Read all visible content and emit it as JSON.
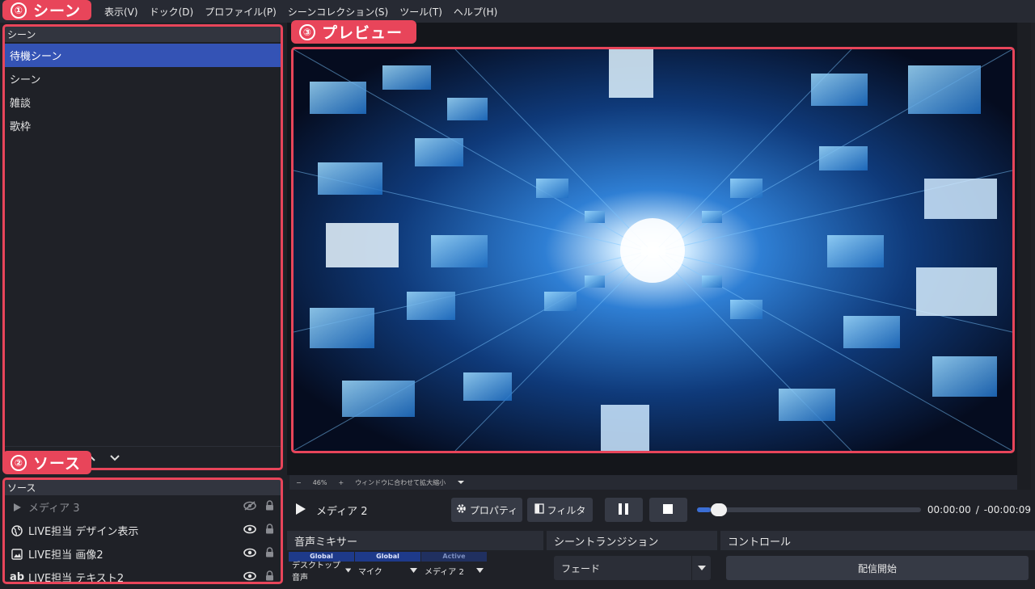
{
  "menu": [
    "表示(V)",
    "ドック(D)",
    "プロファイル(P)",
    "シーンコレクション(S)",
    "ツール(T)",
    "ヘルプ(H)"
  ],
  "callouts": {
    "scene": {
      "num": "①",
      "label": "シーン"
    },
    "source": {
      "num": "②",
      "label": "ソース"
    },
    "preview": {
      "num": "③",
      "label": "プレビュー"
    }
  },
  "scenes": {
    "title": "シーン",
    "items": [
      "待機シーン",
      "シーン",
      "雑談",
      "歌枠"
    ]
  },
  "sources": {
    "title": "ソース",
    "items": [
      {
        "label": "メディア 3"
      },
      {
        "label": "LIVE担当 デザイン表示"
      },
      {
        "label": "LIVE担当 画像2"
      },
      {
        "label": "LIVE担当 テキスト2"
      }
    ]
  },
  "zoom": {
    "minus": "−",
    "value": "46%",
    "plus": "+",
    "fit_label": "ウィンドウに合わせて拡大縮小"
  },
  "media": {
    "name": "メディア 2",
    "properties_label": "プロパティ",
    "filter_label": "フィルタ",
    "time_current": "00:00:00",
    "time_separator": "/",
    "time_remaining": "-00:00:09",
    "progress": 0.06
  },
  "mixer": {
    "title": "音声ミキサー",
    "columns": [
      {
        "head": "Global",
        "label": "デスクトップ音声"
      },
      {
        "head": "Global",
        "label": "マイク"
      },
      {
        "head": "Active",
        "label": "メディア 2"
      }
    ]
  },
  "transition": {
    "title": "シーントランジション",
    "value": "フェード"
  },
  "controls": {
    "title": "コントロール",
    "start_stream": "配信開始"
  },
  "colors": {
    "accent": "#e8455a",
    "selected": "#3453b5"
  }
}
